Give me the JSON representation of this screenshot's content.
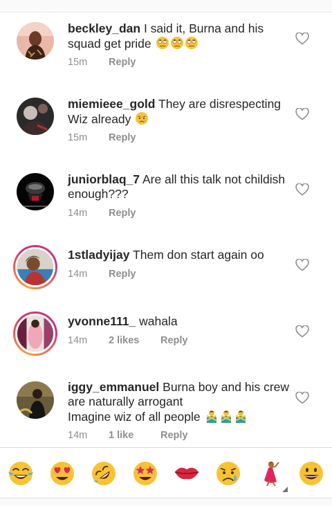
{
  "comments": [
    {
      "username": "beckley_dan",
      "text": "I said it, Burna and his squad get pride",
      "emojis": [
        "face-with-rolling-eyes",
        "face-with-rolling-eyes",
        "face-with-rolling-eyes"
      ],
      "time": "15m",
      "likes": "",
      "reply": "Reply"
    },
    {
      "username": "miemieee_gold",
      "text": "They are disrespecting Wiz already",
      "emojis": [
        "crying-face"
      ],
      "time": "15m",
      "likes": "",
      "reply": "Reply"
    },
    {
      "username": "juniorblaq_7",
      "text": "Are all this talk not childish enough???",
      "emojis": [],
      "time": "14m",
      "likes": "",
      "reply": "Reply"
    },
    {
      "username": "1stladyijay",
      "text": "Them don start again oo",
      "emojis": [],
      "time": "14m",
      "likes": "",
      "reply": "Reply"
    },
    {
      "username": "yvonne111_",
      "text": "wahala",
      "emojis": [],
      "time": "14m",
      "likes": "2 likes",
      "reply": "Reply"
    },
    {
      "username": "iggy_emmanuel",
      "text": "Burna boy and his crew are naturally arrogant\nImagine wiz of all people",
      "emojis": [
        "man-gesturing-no",
        "man-gesturing-no",
        "man-gesturing-no"
      ],
      "time": "14m",
      "likes": "1 like",
      "reply": "Reply"
    }
  ],
  "emoji_bar": [
    "face-with-tears-of-joy",
    "smiling-face-with-heart-eyes",
    "rolling-on-the-floor-laughing",
    "star-struck",
    "kiss-mark",
    "sad-but-relieved-face",
    "woman-dancing",
    "grinning-face"
  ],
  "colors": {
    "text": "#262626",
    "meta": "#8e8e8e",
    "heart_outline": "#8e8e8e",
    "story_ring_start": "#f9a13b",
    "story_ring_end": "#c13584"
  }
}
